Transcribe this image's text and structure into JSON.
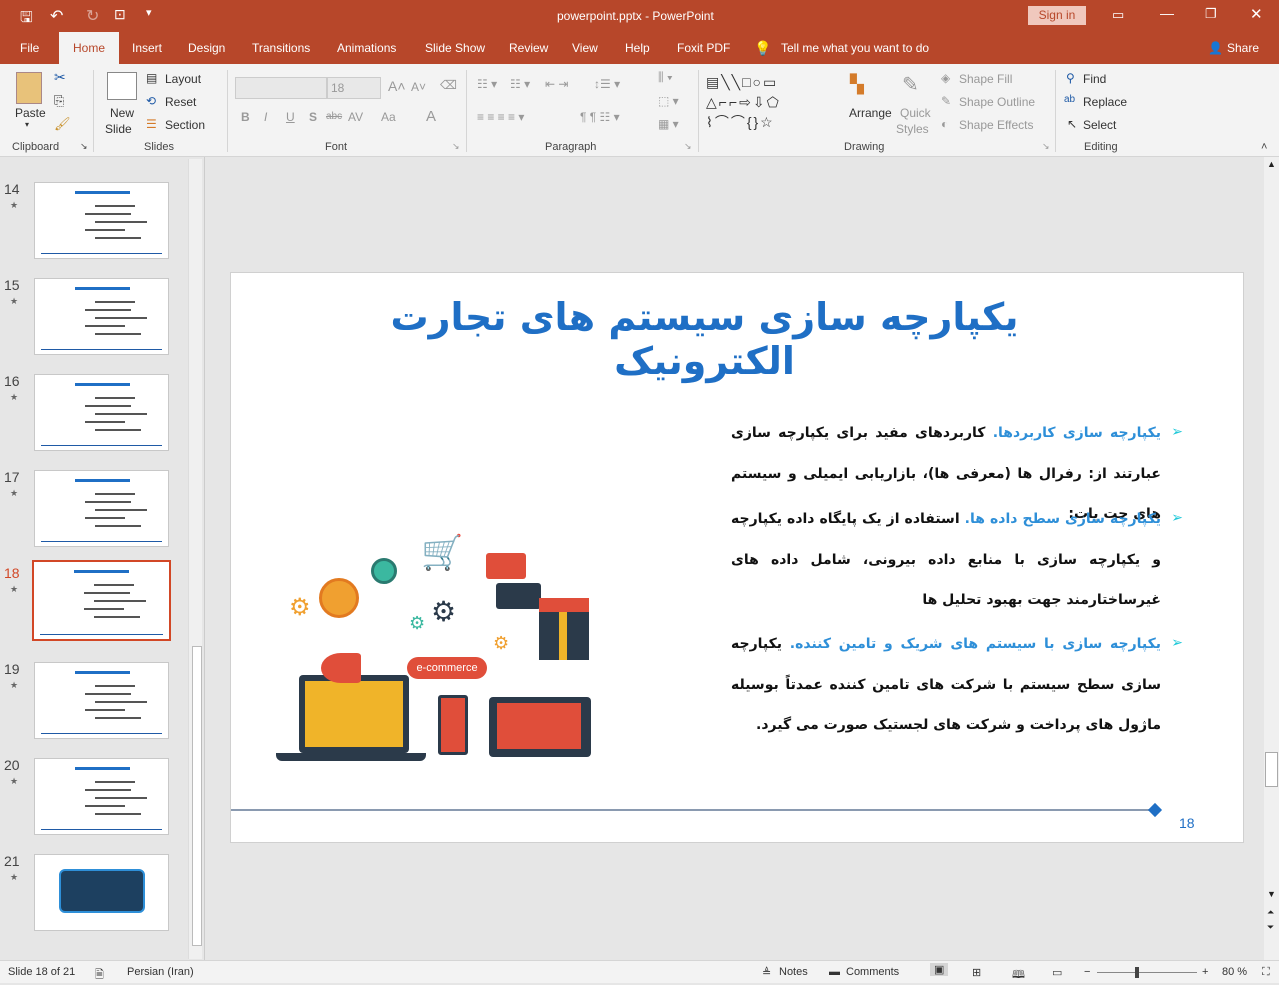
{
  "titlebar": {
    "filename": "powerpoint.pptx",
    "separator": "-",
    "app": "PowerPoint",
    "sign_in": "Sign in"
  },
  "tabs": [
    "File",
    "Home",
    "Insert",
    "Design",
    "Transitions",
    "Animations",
    "Slide Show",
    "Review",
    "View",
    "Help",
    "Foxit PDF"
  ],
  "tell_me": "Tell me what you want to do",
  "share": "Share",
  "ribbon": {
    "clipboard": {
      "label": "Clipboard",
      "paste": "Paste"
    },
    "slides": {
      "label": "Slides",
      "new_slide_1": "New",
      "new_slide_2": "Slide",
      "layout": "Layout",
      "reset": "Reset",
      "section": "Section"
    },
    "font": {
      "label": "Font",
      "size": "18",
      "bold": "B",
      "italic": "I",
      "underline": "U",
      "shadow": "S",
      "strike": "abc",
      "spacing": "AV",
      "case": "Aa",
      "color": "A"
    },
    "paragraph": {
      "label": "Paragraph"
    },
    "drawing": {
      "label": "Drawing",
      "arrange": "Arrange",
      "quick_styles_1": "Quick",
      "quick_styles_2": "Styles",
      "shape_fill": "Shape Fill",
      "shape_outline": "Shape Outline",
      "shape_effects": "Shape Effects"
    },
    "editing": {
      "label": "Editing",
      "find": "Find",
      "replace": "Replace",
      "select": "Select"
    }
  },
  "thumbnails": [
    {
      "num": "14",
      "selected": false
    },
    {
      "num": "15",
      "selected": false
    },
    {
      "num": "16",
      "selected": false
    },
    {
      "num": "17",
      "selected": false
    },
    {
      "num": "18",
      "selected": true
    },
    {
      "num": "19",
      "selected": false
    },
    {
      "num": "20",
      "selected": false
    },
    {
      "num": "21",
      "selected": false
    }
  ],
  "slide": {
    "title": "یکپارچه سازی سیستم های تجارت الکترونیک",
    "bullets": [
      {
        "head": "یکپارچه سازی کاربردها.",
        "body": " کاربردهای مفید برای یکپارچه سازی عبارتند از: رفرال ها (معرفی ها)، بازاریابی ایمیلی و سیستم های چت بات:"
      },
      {
        "head": "یکپارچه سازی سطح داده ها.",
        "body": " استفاده از یک پایگاه داده یکپارچه و یکپارچه سازی با منابع داده بیرونی، شامل داده های غیرساختارمند جهت بهبود تحلیل ها"
      },
      {
        "head": "یکپارچه سازی با سیستم های شریک و تامین کننده.",
        "body": " یکپارچه سازی سطح سیستم با شرکت های تامین کننده عمدتاً بوسیله ماژول های پرداخت و شرکت های لجستیک صورت می گیرد."
      }
    ],
    "ecommerce_label": "e-commerce",
    "page_number": "18"
  },
  "statusbar": {
    "slide_of": "Slide 18 of 21",
    "language": "Persian (Iran)",
    "notes": "Notes",
    "comments": "Comments",
    "zoom": "80 %",
    "minus": "−",
    "plus": "+"
  },
  "colors": {
    "accent": "#b7472a",
    "title_blue": "#1f6fc5",
    "bullet_blue": "#2e8fd8",
    "arrow": "#1ec8d8"
  }
}
